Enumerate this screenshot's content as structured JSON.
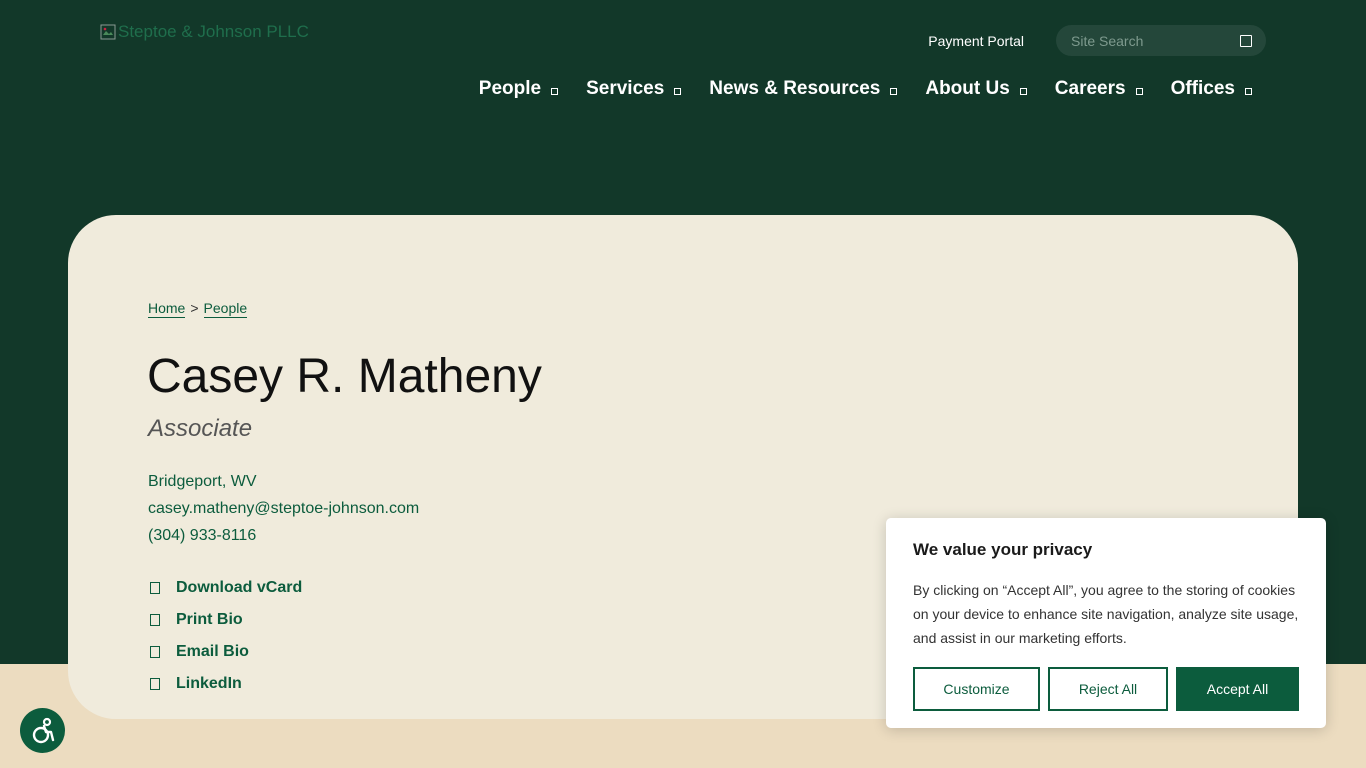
{
  "header": {
    "logo_alt": "Steptoe & Johnson PLLC",
    "payment_portal": "Payment Portal",
    "search_placeholder": "Site Search",
    "nav": [
      {
        "label": "People"
      },
      {
        "label": "Services"
      },
      {
        "label": "News & Resources"
      },
      {
        "label": "About Us"
      },
      {
        "label": "Careers"
      },
      {
        "label": "Offices"
      }
    ]
  },
  "breadcrumb": {
    "home": "Home",
    "separator": ">",
    "current": "People"
  },
  "profile": {
    "name": "Casey R. Matheny",
    "title": "Associate",
    "location": "Bridgeport, WV",
    "email": "casey.matheny@steptoe-johnson.com",
    "phone": "(304) 933-8116"
  },
  "actions": [
    {
      "label": "Download vCard",
      "icon": "vcard-icon"
    },
    {
      "label": "Print Bio",
      "icon": "print-icon"
    },
    {
      "label": "Email Bio",
      "icon": "email-icon"
    },
    {
      "label": "LinkedIn",
      "icon": "linkedin-icon"
    }
  ],
  "cookie": {
    "title": "We value your privacy",
    "text": "By clicking on “Accept All”, you agree to the storing of cookies on your device to enhance site navigation, analyze site usage, and assist in our marketing efforts.",
    "customize": "Customize",
    "reject": "Reject All",
    "accept": "Accept All"
  },
  "colors": {
    "header_bg": "#123829",
    "card_bg": "#f0ebdc",
    "accent": "#0c5c3d",
    "page_bg": "#ecdcc0"
  }
}
